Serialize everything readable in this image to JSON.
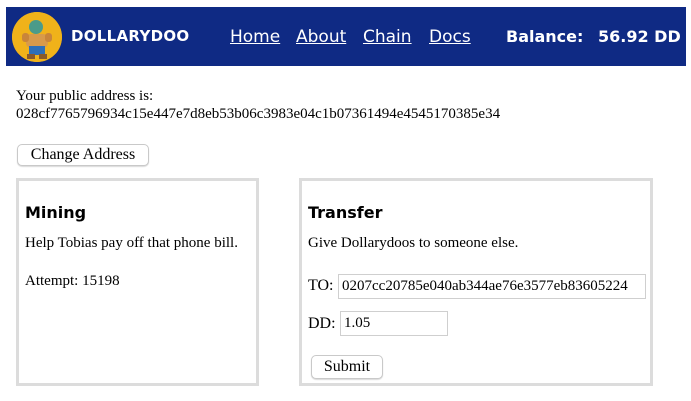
{
  "header": {
    "brand": "DOLLARYDOO",
    "nav": [
      "Home",
      "About",
      "Chain",
      "Docs"
    ],
    "balance_label": "Balance:",
    "balance_value": "56.92 DD"
  },
  "account": {
    "address_label": "Your public address is:",
    "address_value": "028cf7765796934c15e447e7d8eb53b06c3983e04c1b07361494e4545170385e34",
    "change_button": "Change Address"
  },
  "mining": {
    "title": "Mining",
    "description": "Help Tobias pay off that phone bill.",
    "attempt_label": "Attempt: 15198"
  },
  "transfer": {
    "title": "Transfer",
    "description": "Give Dollarydoos to someone else.",
    "to_label": "TO:",
    "to_value": "0207cc20785e040ab344ae76e3577eb83605224",
    "dd_label": "DD:",
    "dd_value": "1.05",
    "submit": "Submit"
  },
  "colors": {
    "navbar": "#0f2a84",
    "logo": "#f0b21a"
  }
}
